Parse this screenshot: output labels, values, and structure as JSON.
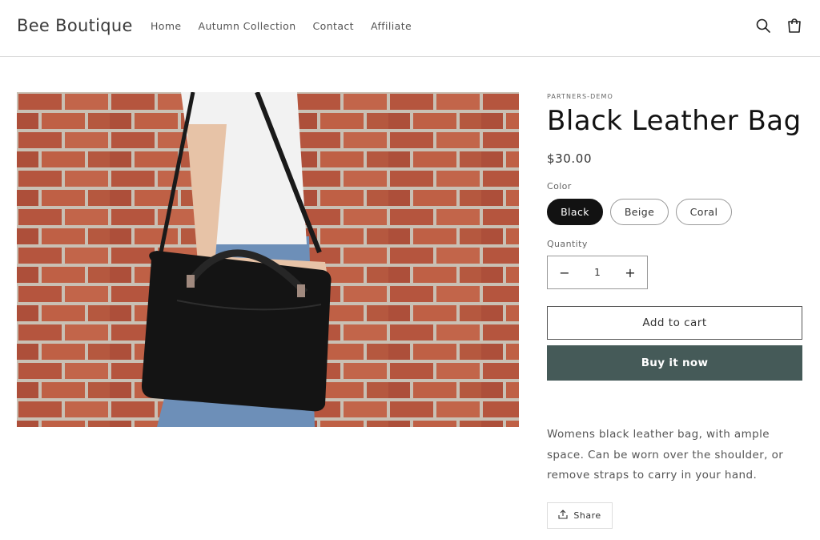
{
  "header": {
    "logo": "Bee Boutique",
    "nav": [
      "Home",
      "Autumn Collection",
      "Contact",
      "Affiliate"
    ],
    "icons": [
      "search-icon",
      "cart-icon"
    ]
  },
  "product": {
    "vendor": "PARTNERS-DEMO",
    "title": "Black Leather Bag",
    "price": "$30.00",
    "color_label": "Color",
    "colors": [
      {
        "label": "Black",
        "selected": true
      },
      {
        "label": "Beige",
        "selected": false
      },
      {
        "label": "Coral",
        "selected": false
      }
    ],
    "quantity_label": "Quantity",
    "quantity": "1",
    "decrease_symbol": "−",
    "increase_symbol": "+",
    "add_to_cart": "Add to cart",
    "buy_now": "Buy it now",
    "description": "Womens black leather bag, with ample space. Can be worn over the shoulder, or remove straps to carry in your hand.",
    "share": "Share"
  },
  "colors": {
    "buy_button": "#455a58",
    "selected_swatch": "#121212",
    "brick": "#b85c44"
  }
}
